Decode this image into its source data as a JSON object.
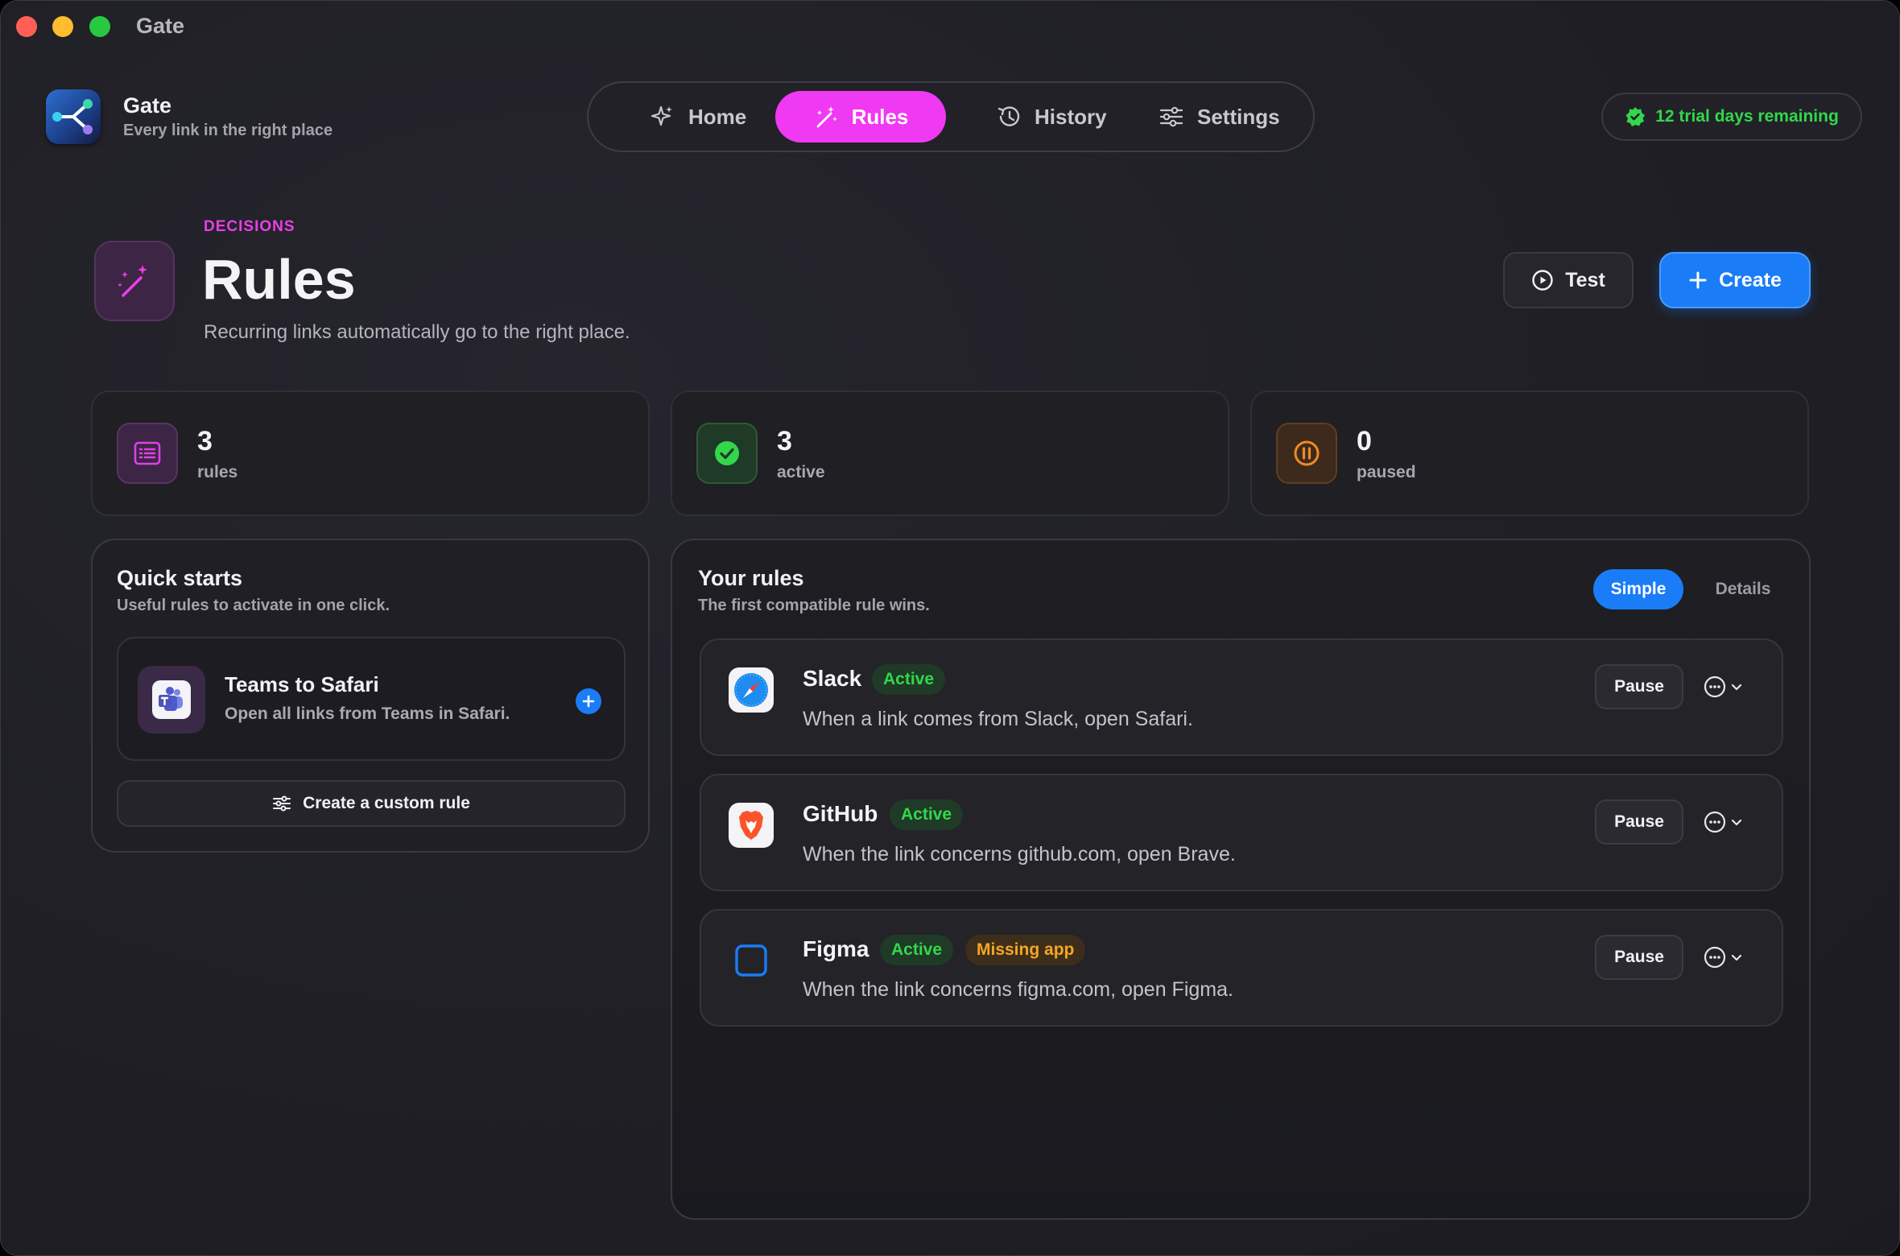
{
  "window": {
    "title": "Gate"
  },
  "header": {
    "app_name": "Gate",
    "app_tagline": "Every link in the right place",
    "nav": [
      {
        "label": "Home",
        "icon": "sparkle-icon"
      },
      {
        "label": "Rules",
        "icon": "magic-wand-icon",
        "active": true
      },
      {
        "label": "History",
        "icon": "history-icon"
      },
      {
        "label": "Settings",
        "icon": "sliders-icon"
      }
    ],
    "trial_label": "12 trial days remaining"
  },
  "page": {
    "eyebrow": "DECISIONS",
    "title": "Rules",
    "subtitle": "Recurring links automatically go to the right place.",
    "test_label": "Test",
    "create_label": "Create"
  },
  "stats": [
    {
      "value": "3",
      "label": "rules",
      "icon": "list-icon"
    },
    {
      "value": "3",
      "label": "active",
      "icon": "checkmark-icon"
    },
    {
      "value": "0",
      "label": "paused",
      "icon": "pause-icon"
    }
  ],
  "quick_starts": {
    "title": "Quick starts",
    "subtitle": "Useful rules to activate in one click.",
    "items": [
      {
        "title": "Teams to Safari",
        "description": "Open all links from Teams in Safari.",
        "icon": "teams-icon"
      }
    ],
    "custom_label": "Create a custom rule"
  },
  "rules": {
    "title": "Your rules",
    "subtitle": "The first compatible rule wins.",
    "view_simple": "Simple",
    "view_details": "Details",
    "items": [
      {
        "name": "Slack",
        "status": "Active",
        "description": "When a link comes from Slack, open Safari.",
        "icon": "safari-icon",
        "pause_label": "Pause"
      },
      {
        "name": "GitHub",
        "status": "Active",
        "description": "When the link concerns github.com, open Brave.",
        "icon": "brave-icon",
        "pause_label": "Pause"
      },
      {
        "name": "Figma",
        "status": "Active",
        "warning": "Missing app",
        "description": "When the link concerns figma.com, open Figma.",
        "icon": "missing-app-icon",
        "pause_label": "Pause"
      }
    ]
  },
  "colors": {
    "accent_pink": "#f039f2",
    "accent_blue": "#1a7cf7",
    "success_green": "#32d74b",
    "warning_orange": "#f5a623"
  }
}
